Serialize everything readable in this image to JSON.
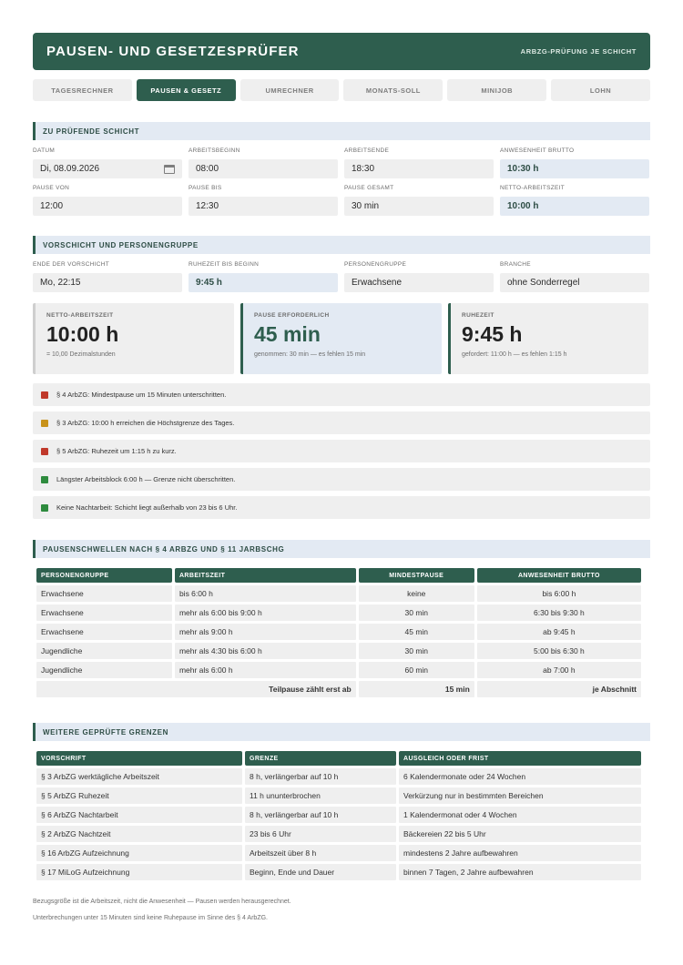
{
  "header": {
    "title": "PAUSEN- UND GESETZESPRÜFER",
    "subtitle": "ARBZG-PRÜFUNG JE SCHICHT"
  },
  "tabs": [
    "TAGESRECHNER",
    "PAUSEN & GESETZ",
    "UMRECHNER",
    "MONATS-SOLL",
    "MINIJOB",
    "LOHN"
  ],
  "active_tab": "PAUSEN & GESETZ",
  "shift": {
    "heading": "ZU PRÜFENDE SCHICHT",
    "datum_label": "DATUM",
    "datum_value": "Di, 08.09.2026",
    "beginn_label": "ARBEITSBEGINN",
    "beginn_value": "08:00",
    "ende_label": "ARBEITSENDE",
    "ende_value": "18:30",
    "brutto_label": "ANWESENHEIT BRUTTO",
    "brutto_value": "10:30 h",
    "pause_von_label": "PAUSE VON",
    "pause_von_value": "12:00",
    "pause_bis_label": "PAUSE BIS",
    "pause_bis_value": "12:30",
    "pause_gesamt_label": "PAUSE GESAMT",
    "pause_gesamt_value": "30 min",
    "netto_label": "NETTO-ARBEITSZEIT",
    "netto_value": "10:00 h"
  },
  "prev": {
    "heading": "VORSCHICHT UND PERSONENGRUPPE",
    "ende_label": "ENDE DER VORSCHICHT",
    "ende_value": "Mo, 22:15",
    "ruhe_label": "RUHEZEIT BIS BEGINN",
    "ruhe_value": "9:45 h",
    "gruppe_label": "PERSONENGRUPPE",
    "gruppe_value": "Erwachsene",
    "branche_label": "BRANCHE",
    "branche_value": "ohne Sonderregel"
  },
  "cards": [
    {
      "label": "NETTO-ARBEITSZEIT",
      "value": "10:00 h",
      "note": "= 10,00 Dezimalstunden"
    },
    {
      "label": "PAUSE ERFORDERLICH",
      "value": "45 min",
      "note": "genommen: 30 min — es fehlen 15 min"
    },
    {
      "label": "RUHEZEIT",
      "value": "9:45 h",
      "note": "gefordert: 11:00 h — es fehlen 1:15 h"
    }
  ],
  "messages": [
    {
      "text": "§ 4 ArbZG: Mindestpause um 15 Minuten unterschritten.",
      "color": "#c0392b"
    },
    {
      "text": "§ 3 ArbZG: 10:00 h erreichen die Höchstgrenze des Tages.",
      "color": "#c8921a"
    },
    {
      "text": "§ 5 ArbZG: Ruhezeit um 1:15 h zu kurz.",
      "color": "#c0392b"
    },
    {
      "text": "Längster Arbeitsblock 6:00 h — Grenze nicht überschritten.",
      "color": "#2e8b3e"
    },
    {
      "text": "Keine Nachtarbeit: Schicht liegt außerhalb von 23 bis 6 Uhr.",
      "color": "#2e8b3e"
    }
  ],
  "thresholds": {
    "heading": "PAUSENSCHWELLEN NACH § 4 ARBZG UND § 11 JARBSCHG",
    "columns": [
      "PERSONENGRUPPE",
      "ARBEITSZEIT",
      "MINDESTPAUSE",
      "ANWESENHEIT BRUTTO"
    ],
    "rows": [
      [
        "Erwachsene",
        "bis 6:00 h",
        "keine",
        "bis 6:00 h"
      ],
      [
        "Erwachsene",
        "mehr als 6:00 bis 9:00 h",
        "30 min",
        "6:30 bis 9:30 h"
      ],
      [
        "Erwachsene",
        "mehr als 9:00 h",
        "45 min",
        "ab 9:45 h"
      ],
      [
        "Jugendliche",
        "mehr als 4:30 bis 6:00 h",
        "30 min",
        "5:00 bis 6:30 h"
      ],
      [
        "Jugendliche",
        "mehr als 6:00 h",
        "60 min",
        "ab 7:00 h"
      ]
    ],
    "footer": [
      "Teilpause zählt erst ab",
      "15 min",
      "je Abschnitt"
    ]
  },
  "limits": {
    "heading": "WEITERE GEPRÜFTE GRENZEN",
    "columns": [
      "VORSCHRIFT",
      "GRENZE",
      "AUSGLEICH ODER FRIST"
    ],
    "rows": [
      [
        "§ 3 ArbZG werktägliche Arbeitszeit",
        "8 h, verlängerbar auf 10 h",
        "6 Kalendermonate oder 24 Wochen"
      ],
      [
        "§ 5 ArbZG Ruhezeit",
        "11 h ununterbrochen",
        "Verkürzung nur in bestimmten Bereichen"
      ],
      [
        "§ 6 ArbZG Nachtarbeit",
        "8 h, verlängerbar auf 10 h",
        "1 Kalendermonat oder 4 Wochen"
      ],
      [
        "§ 2 ArbZG Nachtzeit",
        "23 bis 6 Uhr",
        "Bäckereien 22 bis 5 Uhr"
      ],
      [
        "§ 16 ArbZG Aufzeichnung",
        "Arbeitszeit über 8 h",
        "mindestens 2 Jahre aufbewahren"
      ],
      [
        "§ 17 MiLoG Aufzeichnung",
        "Beginn, Ende und Dauer",
        "binnen 7 Tagen, 2 Jahre aufbewahren"
      ]
    ]
  },
  "footnotes": [
    "Bezugsgröße ist die Arbeitszeit, nicht die Anwesenheit — Pausen werden herausgerechnet.",
    "Unterbrechungen unter 15 Minuten sind keine Ruhepause im Sinne des § 4 ArbZG."
  ]
}
